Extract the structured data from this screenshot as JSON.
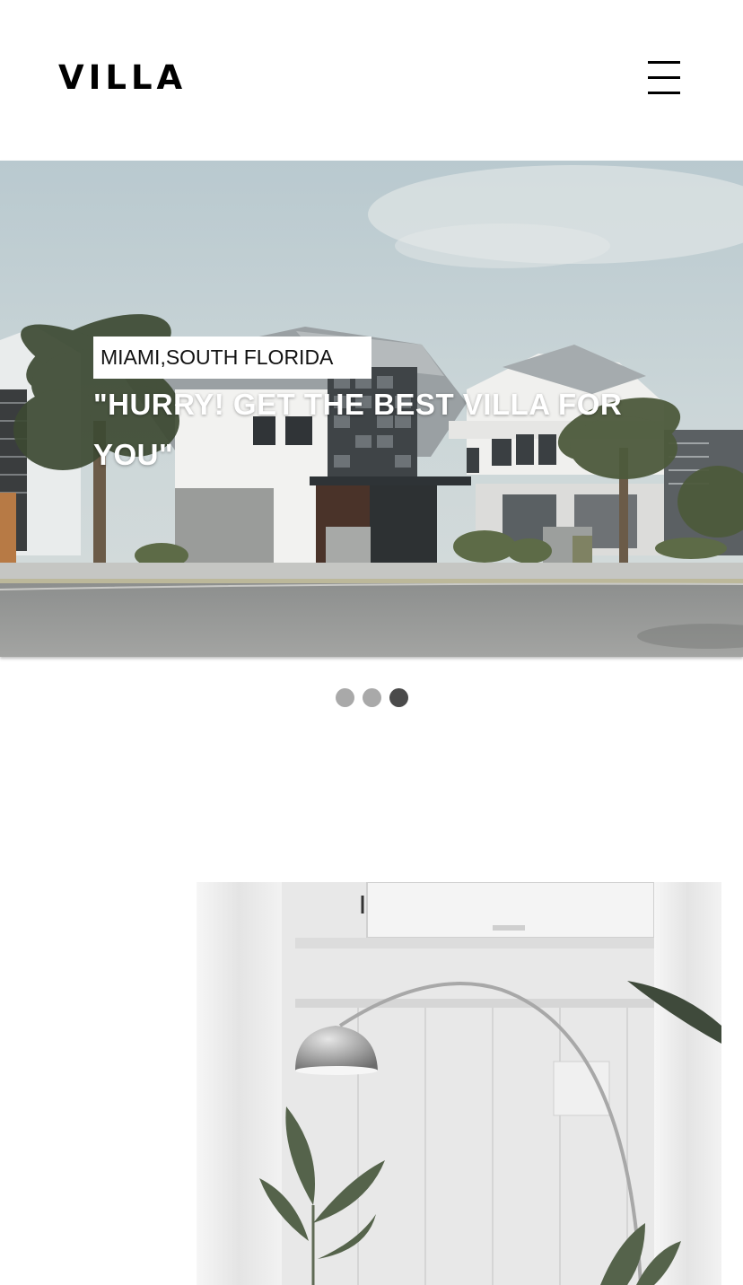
{
  "header": {
    "logo": "VILLA",
    "menu_icon": "hamburger-menu-icon"
  },
  "hero": {
    "location": "MIAMI,SOUTH FLORIDA",
    "headline": "\"HURRY! GET THE BEST VILLA FOR YOU\"",
    "image": "modern-villa-street-photo"
  },
  "carousel": {
    "slide_count": 3,
    "active_slide": 3,
    "inactive_color": "#a9a9a9",
    "active_color": "#4a4a4a"
  },
  "interior_image": "white-interior-arc-lamp-plant-photo"
}
